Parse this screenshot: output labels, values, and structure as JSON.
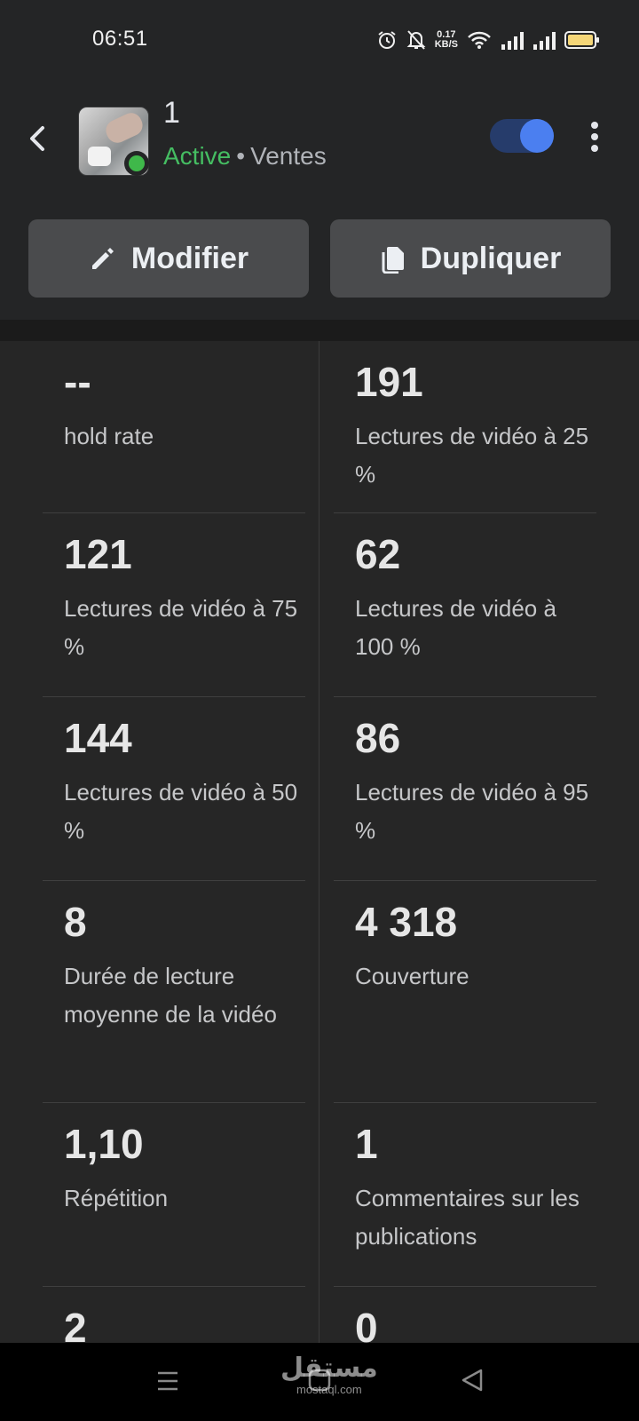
{
  "status_bar": {
    "time": "06:51",
    "net_speed_value": "0.17",
    "net_speed_unit": "KB/S",
    "icons": [
      "alarm-icon",
      "mute-icon",
      "wifi-icon",
      "signal-icon",
      "signal-icon",
      "battery-icon"
    ]
  },
  "header": {
    "title": "1",
    "status": "Active",
    "separator": "•",
    "objective": "Ventes",
    "toggle_on": true,
    "accent_color": "#4b7ff0",
    "status_color": "#45bd62"
  },
  "actions": {
    "edit_label": "Modifier",
    "duplicate_label": "Dupliquer"
  },
  "metrics": {
    "left": [
      {
        "value": "--",
        "label": "hold rate"
      },
      {
        "value": "121",
        "label": "Lectures de vidéo à 75 %"
      },
      {
        "value": "144",
        "label": "Lectures de vidéo à 50 %"
      },
      {
        "value": "8",
        "label": "Durée de lecture moyenne de la vidéo"
      },
      {
        "value": "1,10",
        "label": "Répétition"
      },
      {
        "value": "2",
        "label": ""
      }
    ],
    "right": [
      {
        "value": "191",
        "label": "Lectures de vidéo à 25 %"
      },
      {
        "value": "62",
        "label": "Lectures de vidéo à 100 %"
      },
      {
        "value": "86",
        "label": "Lectures de vidéo à 95 %"
      },
      {
        "value": "4 318",
        "label": "Couverture"
      },
      {
        "value": "1",
        "label": "Commentaires sur les publications"
      },
      {
        "value": "0",
        "label": ""
      }
    ]
  },
  "watermark": {
    "arabic": "مستقل",
    "latin": "mostaql.com"
  }
}
